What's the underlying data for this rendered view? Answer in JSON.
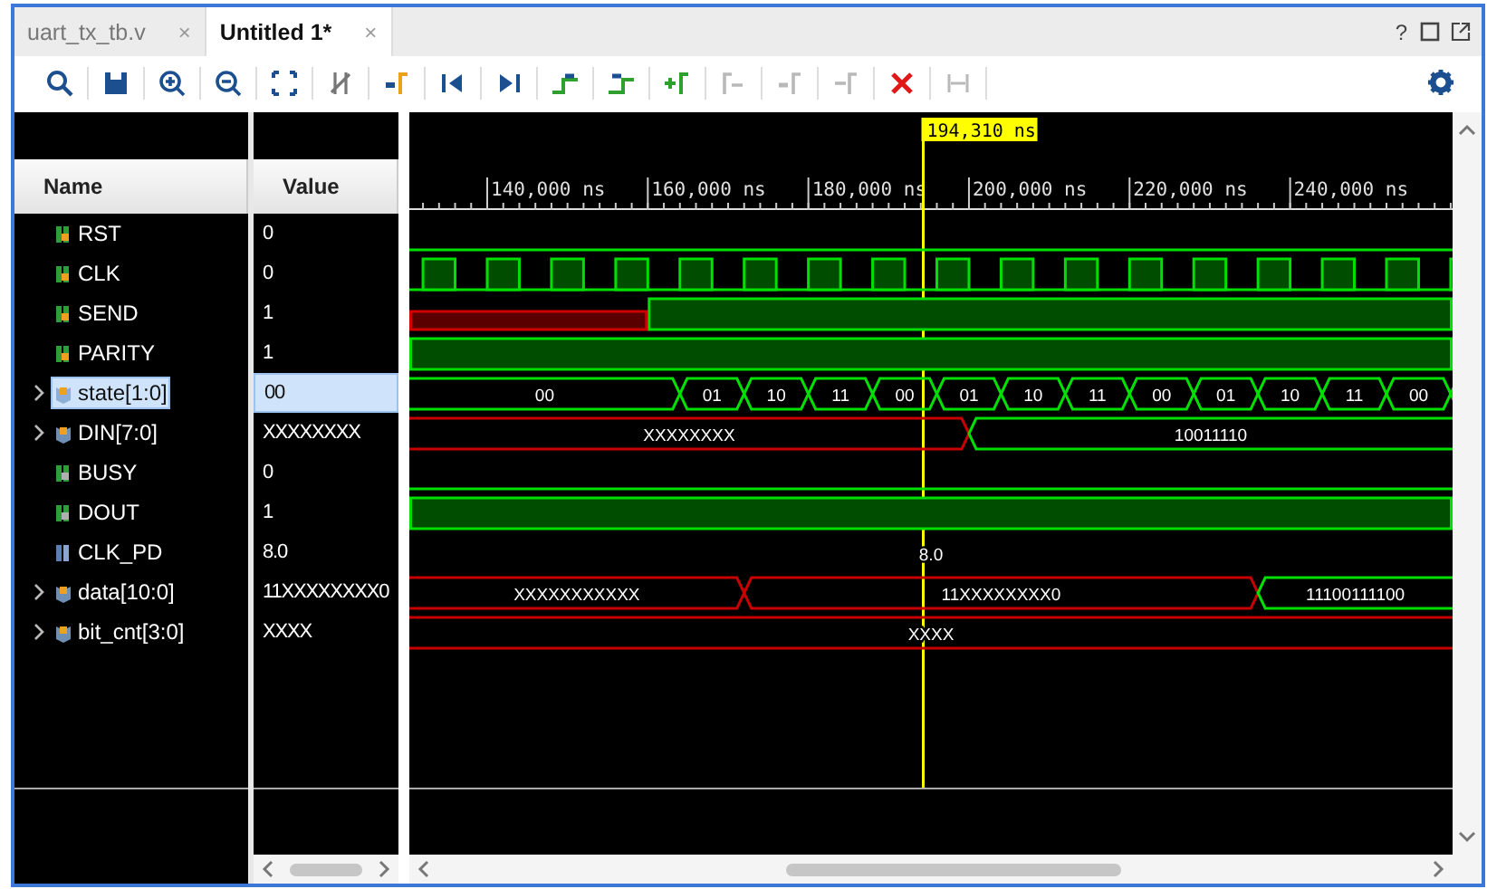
{
  "tabs": [
    {
      "label": "uart_tx_tb.v",
      "close": "×",
      "selected": false
    },
    {
      "label": "Untitled 1*",
      "close": "×",
      "selected": true
    }
  ],
  "window_controls": {
    "help": "?"
  },
  "toolbar": [
    {
      "disabled": false
    },
    {
      "disabled": false
    },
    {
      "disabled": false
    },
    {
      "disabled": false
    },
    {
      "disabled": false
    },
    {
      "disabled": false
    },
    {
      "disabled": false
    },
    {
      "disabled": false
    },
    {
      "disabled": false
    },
    {
      "disabled": false
    },
    {
      "disabled": false
    },
    {
      "disabled": false
    },
    {
      "disabled": true
    },
    {
      "disabled": true
    },
    {
      "disabled": true
    },
    {
      "disabled": false
    },
    {
      "disabled": true
    }
  ],
  "columns": {
    "name": "Name",
    "value": "Value"
  },
  "timeline": {
    "ticks": [
      "140,000 ns",
      "160,000 ns",
      "180,000 ns",
      "200,000 ns",
      "220,000 ns",
      "240,000 ns"
    ],
    "cursor": "194,310 ns"
  },
  "signals": [
    {
      "name": "RST",
      "value": "0",
      "kind": "low",
      "output": false,
      "selected": false
    },
    {
      "name": "CLK",
      "value": "0",
      "kind": "clock",
      "output": false,
      "selected": false
    },
    {
      "name": "SEND",
      "value": "1",
      "kind": "rising",
      "output": false,
      "selected": false
    },
    {
      "name": "PARITY",
      "value": "1",
      "kind": "high",
      "output": false,
      "selected": false
    },
    {
      "name": "state[1:0]",
      "value": "00",
      "kind": "bus",
      "selected": true,
      "expanded": false,
      "segments": [
        {
          "label": "00",
          "unknown": false
        },
        {
          "label": "01",
          "unknown": false
        },
        {
          "label": "10",
          "unknown": false
        },
        {
          "label": "11",
          "unknown": false
        },
        {
          "label": "00",
          "unknown": false
        },
        {
          "label": "01",
          "unknown": false
        },
        {
          "label": "10",
          "unknown": false
        },
        {
          "label": "11",
          "unknown": false
        },
        {
          "label": "00",
          "unknown": false
        },
        {
          "label": "01",
          "unknown": false
        },
        {
          "label": "10",
          "unknown": false
        },
        {
          "label": "11",
          "unknown": false
        },
        {
          "label": "00",
          "unknown": false
        }
      ]
    },
    {
      "name": "DIN[7:0]",
      "value": "XXXXXXXX",
      "kind": "bus",
      "selected": false,
      "expanded": false,
      "segments": [
        {
          "label": "XXXXXXXX",
          "unknown": true
        },
        {
          "label": "10011110",
          "unknown": false
        }
      ]
    },
    {
      "name": "BUSY",
      "value": "0",
      "kind": "low",
      "output": true,
      "selected": false
    },
    {
      "name": "DOUT",
      "value": "1",
      "kind": "high",
      "output": true,
      "selected": false
    },
    {
      "name": "CLK_PD",
      "value": "8.0",
      "kind": "real",
      "selected": false,
      "segments": [
        {
          "label": "8.0"
        }
      ]
    },
    {
      "name": "data[10:0]",
      "value": "11XXXXXXXX0",
      "kind": "bus",
      "selected": false,
      "expanded": false,
      "segments": [
        {
          "label": "XXXXXXXXXXX",
          "unknown": true
        },
        {
          "label": "11XXXXXXXX0",
          "unknown": true
        },
        {
          "label": "11100111100",
          "unknown": false
        }
      ]
    },
    {
      "name": "bit_cnt[3:0]",
      "value": "XXXX",
      "kind": "bus",
      "selected": false,
      "expanded": false,
      "segments": [
        {
          "label": "XXXX",
          "unknown": true
        }
      ]
    }
  ]
}
